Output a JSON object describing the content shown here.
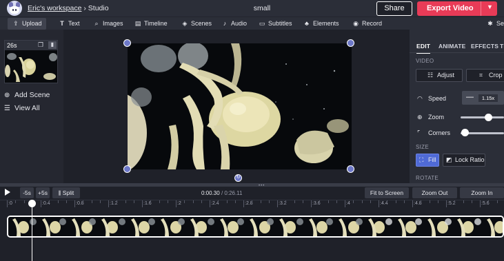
{
  "header": {
    "workspace": "Eric's workspace",
    "separator": "›",
    "section": "Studio",
    "project_name": "small",
    "share_label": "Share",
    "export_label": "Export Video",
    "export_menu_icon": "chevron-down-icon"
  },
  "toolbar": {
    "items": [
      {
        "label": "Upload",
        "icon": "upload-icon",
        "glyph": "⇪",
        "active": true
      },
      {
        "label": "Text",
        "icon": "text-icon",
        "glyph": "T"
      },
      {
        "label": "Images",
        "icon": "search-icon",
        "glyph": "⌕"
      },
      {
        "label": "Timeline",
        "icon": "timeline-icon",
        "glyph": "▤"
      },
      {
        "label": "Scenes",
        "icon": "layers-icon",
        "glyph": "◈"
      },
      {
        "label": "Audio",
        "icon": "music-note-icon",
        "glyph": "♪"
      },
      {
        "label": "Subtitles",
        "icon": "subtitles-icon",
        "glyph": "▭"
      },
      {
        "label": "Elements",
        "icon": "shapes-icon",
        "glyph": "♣"
      },
      {
        "label": "Record",
        "icon": "record-icon",
        "glyph": "◉"
      },
      {
        "label": "Settings",
        "icon": "gear-icon",
        "glyph": "✱"
      }
    ]
  },
  "scenes": {
    "current_duration": "26s",
    "add_scene_label": "Add Scene",
    "view_all_label": "View All"
  },
  "right_panel": {
    "tabs": [
      "EDIT",
      "ANIMATE",
      "EFFECTS",
      "TRANSITIONS"
    ],
    "active_tab": "EDIT",
    "video_section": "VIDEO",
    "adjust_label": "Adjust",
    "crop_label": "Crop",
    "speed_label": "Speed",
    "speed_value": "1.15x",
    "zoom_label": "Zoom",
    "zoom_level": 0.4,
    "corners_label": "Corners",
    "corners_level": 0.0,
    "size_section": "SIZE",
    "fill_label": "Fill",
    "lock_ratio_label": "Lock Ratio",
    "rotate_section": "ROTATE"
  },
  "timeline": {
    "back_label": "-5s",
    "forward_label": "+5s",
    "split_label": "Split",
    "current_time": "0:00.30",
    "total_time": "0:26.11",
    "fit_label": "Fit to Screen",
    "zoom_out_label": "Zoom Out",
    "zoom_in_label": "Zoom In",
    "ruler_labels": [
      ":0",
      ":0.4",
      ":0.8",
      ":1.2",
      ":1.6",
      ":2",
      ":2.4",
      ":2.8",
      ":3.2",
      ":3.6",
      ":4",
      ":4.4",
      ":4.8",
      ":5.2",
      ":5.6"
    ]
  },
  "colors": {
    "accent": "#6d78c8",
    "export": "#e83b57",
    "background": "#1f2129",
    "panel": "#2b2e38"
  }
}
